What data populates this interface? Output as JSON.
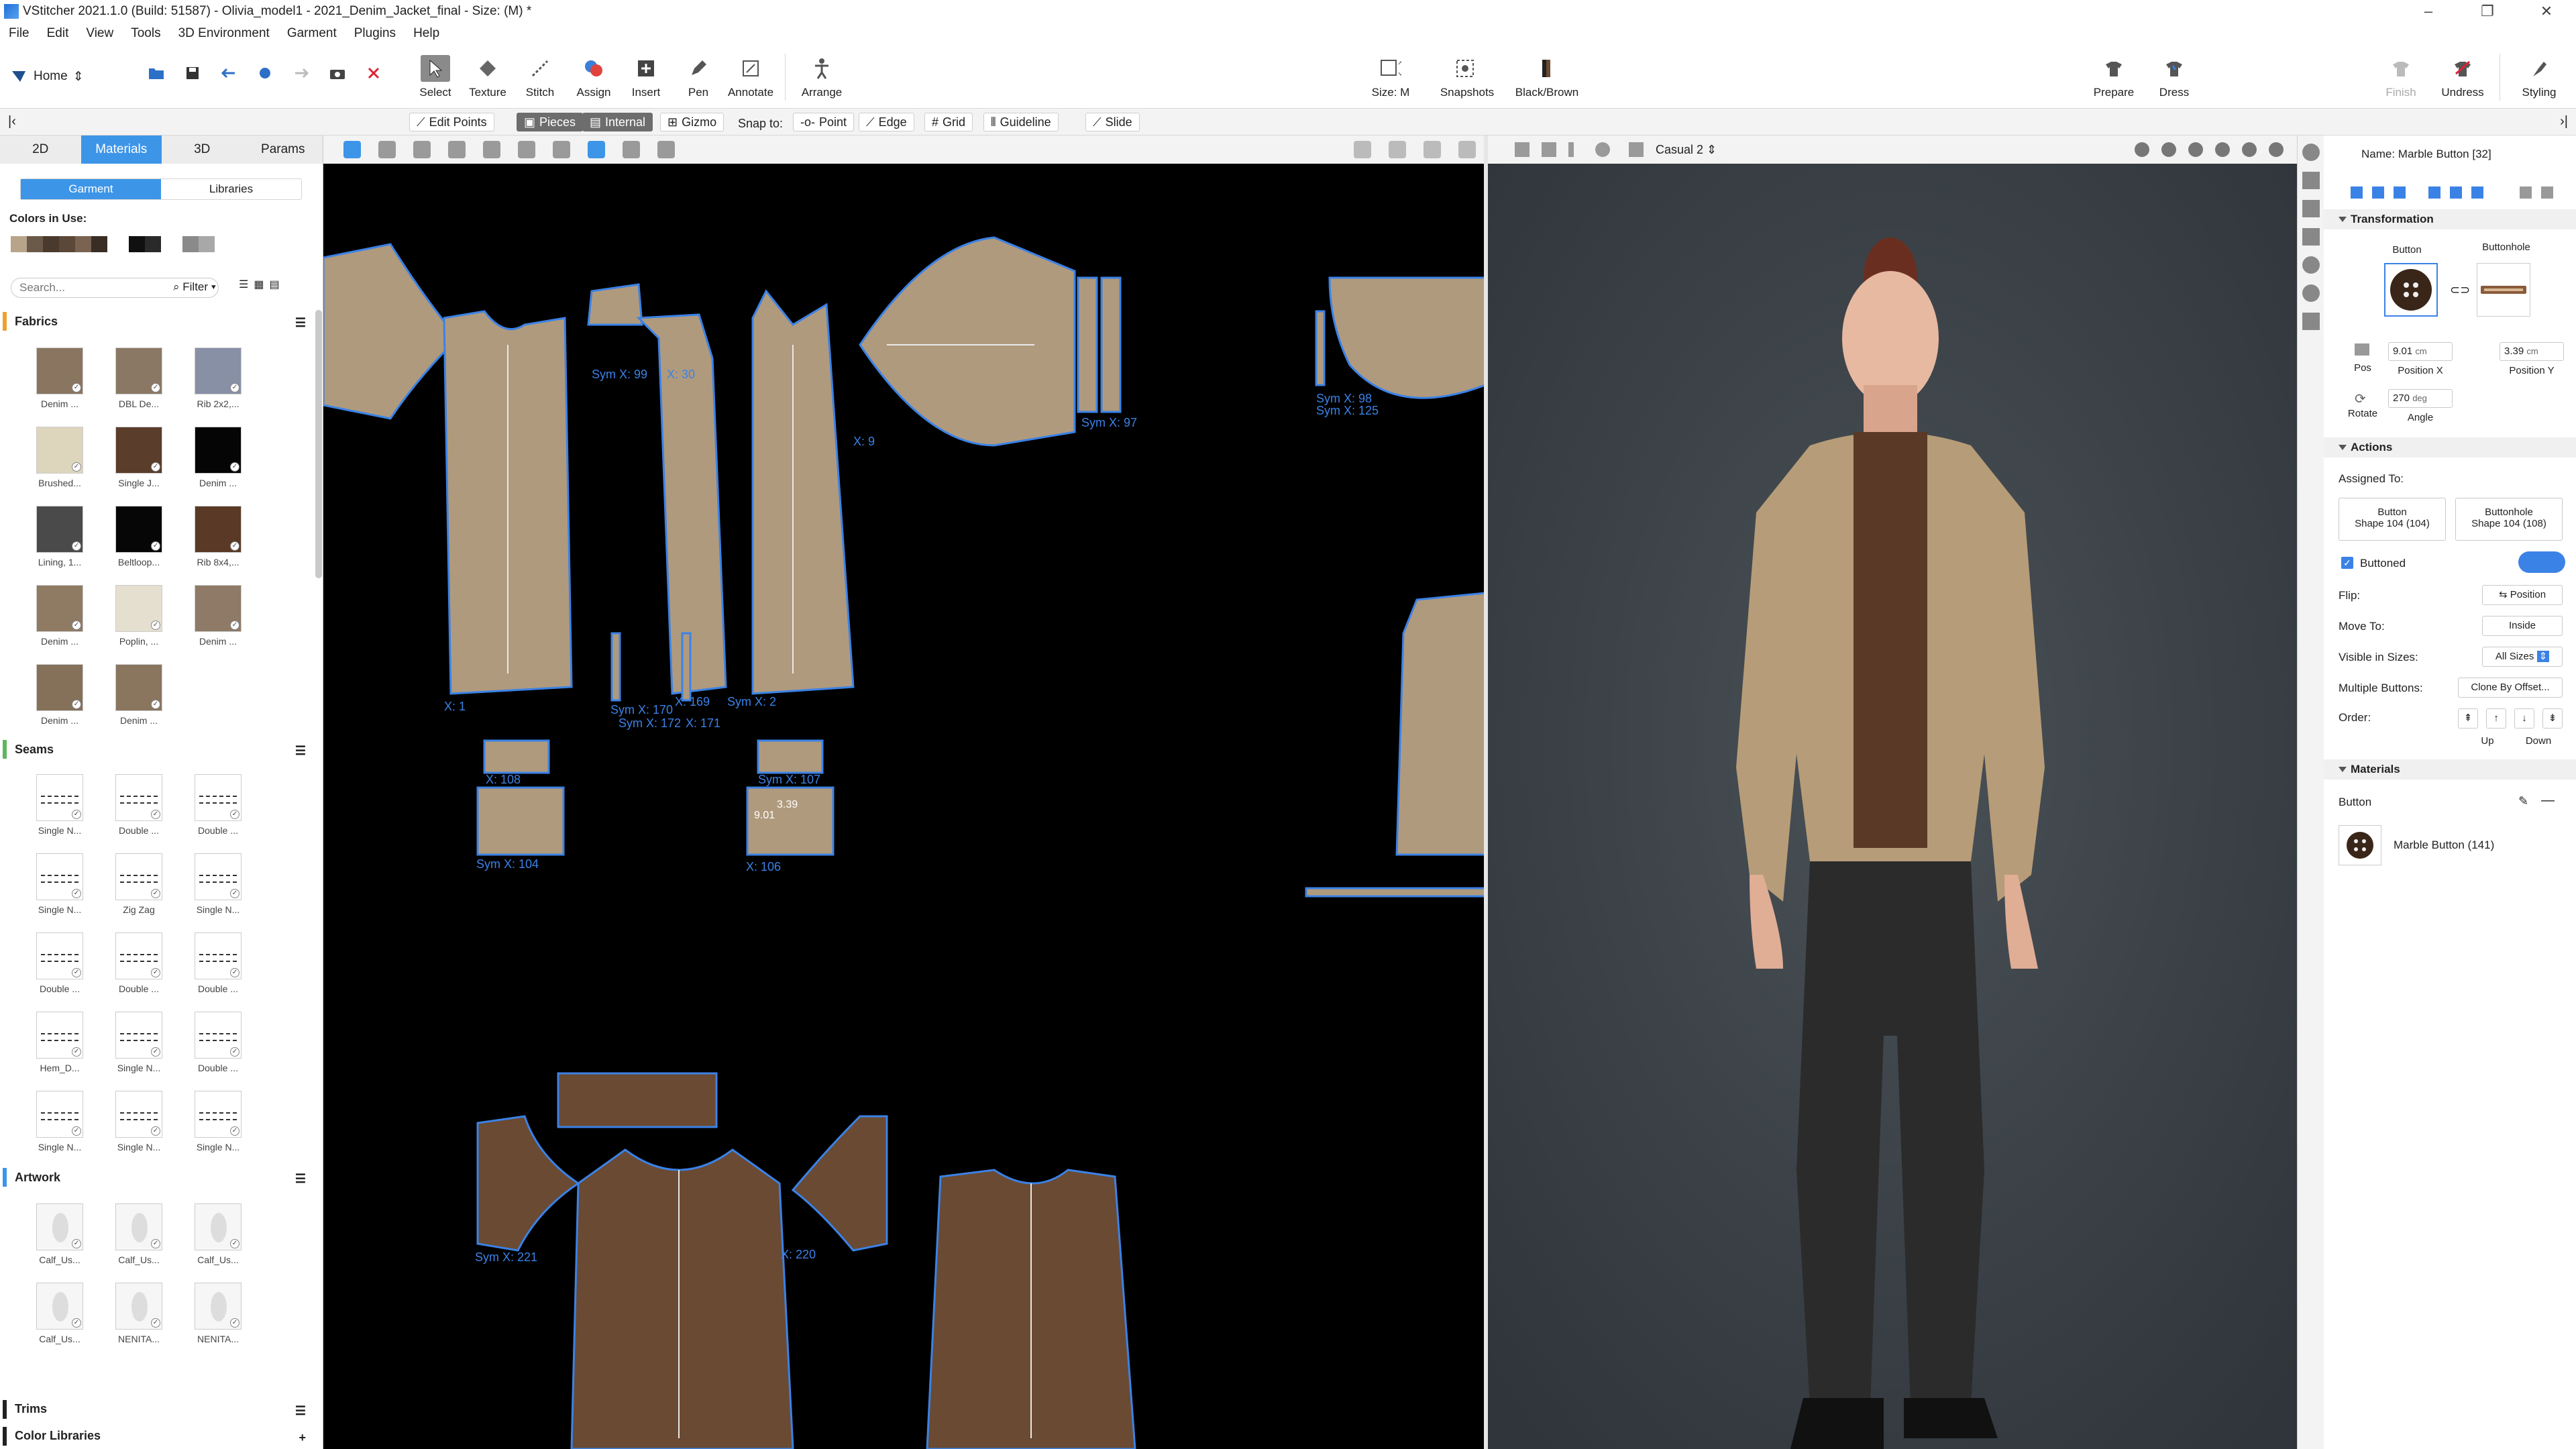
{
  "window": {
    "title": "VStitcher 2021.1.0 (Build: 51587) - Olivia_model1 - 2021_Denim_Jacket_final - Size: (M) *",
    "controls": [
      "–",
      "❐",
      "✕"
    ]
  },
  "menu": [
    "File",
    "Edit",
    "View",
    "Tools",
    "3D Environment",
    "Garment",
    "Plugins",
    "Help"
  ],
  "toolbar": {
    "home_label": "Home",
    "tools": [
      "Select",
      "Texture",
      "Stitch",
      "Assign",
      "Insert",
      "Pen",
      "Annotate",
      "Arrange"
    ],
    "size_label": "Size: M",
    "snapshots_label": "Snapshots",
    "colorway_label": "Black/Brown",
    "right_tools": [
      "Prepare",
      "Dress",
      "Finish",
      "Undress",
      "Styling"
    ]
  },
  "subtoolbar": {
    "edit_points": "Edit Points",
    "pieces": "Pieces",
    "internal": "Internal",
    "gizmo": "Gizmo",
    "snap_to": "Snap to:",
    "point": "Point",
    "edge": "Edge",
    "grid": "Grid",
    "guideline": "Guideline",
    "slide": "Slide"
  },
  "left_panel": {
    "tabs": [
      "2D",
      "Materials",
      "3D",
      "Params"
    ],
    "active_tab": "Materials",
    "segment": [
      "Garment",
      "Libraries"
    ],
    "colors_in_use_label": "Colors in Use:",
    "colors_in_use": [
      "#b8a48a",
      "#6b5a4a",
      "#4a3a2e",
      "#5c4838",
      "#7a6350",
      "#3a2d24",
      "#ffffff",
      "#101010",
      "#2a2a2a",
      "#ffffff",
      "#8a8a8a",
      "#a8a8a8"
    ],
    "search_placeholder": "Search...",
    "filter_label": "Filter",
    "sections": {
      "fabrics": "Fabrics",
      "seams": "Seams",
      "artwork": "Artwork",
      "trims": "Trims",
      "color_libraries": "Color Libraries"
    },
    "fabrics": [
      {
        "label": "Denim ...",
        "color": "#8a7560"
      },
      {
        "label": "DBL De...",
        "color": "#8a7864"
      },
      {
        "label": "Rib 2x2,...",
        "color": "#8890a6"
      },
      {
        "label": "Brushed...",
        "color": "#ddd5bc"
      },
      {
        "label": "Single J...",
        "color": "#5a3d2a"
      },
      {
        "label": "Denim ...",
        "color": "#050505"
      },
      {
        "label": "Lining, 1...",
        "color": "#4a4a4a"
      },
      {
        "label": "Beltloop...",
        "color": "#060606"
      },
      {
        "label": "Rib 8x4,...",
        "color": "#5a3a26"
      },
      {
        "label": "Denim ...",
        "color": "#8f7a64"
      },
      {
        "label": "Poplin, ...",
        "color": "#e4dfcf"
      },
      {
        "label": "Denim ...",
        "color": "#8e7a66"
      },
      {
        "label": "Denim ...",
        "color": "#85705a"
      },
      {
        "label": "Denim ...",
        "color": "#8a755f"
      }
    ],
    "seams": [
      "Single N...",
      "Double ...",
      "Double ...",
      "Single N...",
      "Zig Zag",
      "Single N...",
      "Double ...",
      "Double ...",
      "Double ...",
      "Hem_D...",
      "Single N...",
      "Double ...",
      "Single N...",
      "Single N...",
      "Single N..."
    ],
    "artwork": [
      "Calf_Us...",
      "Calf_Us...",
      "Calf_Us...",
      "Calf_Us...",
      "NENITA...",
      "NENITA..."
    ]
  },
  "pattern_labels": [
    "Sym X: 99",
    "X: 30",
    "X: 9",
    "X: 1",
    "Sym X: 170",
    "X: 169",
    "Sym X: 2",
    "Sym X: 172",
    "X: 171",
    "X: 108",
    "Sym X: 107",
    "Sym X: 104",
    "X: 106",
    "Sym X: 97",
    "Sym X: 98",
    "Sym X: 125",
    "Sym X: 221",
    "X: 220",
    "9.01",
    "3.39"
  ],
  "view3d": {
    "environment_label": "Casual 2"
  },
  "right_panel": {
    "name": "Name: Marble Button [32]",
    "transformation": "Transformation",
    "button_label": "Button",
    "buttonhole_label": "Buttonhole",
    "pos_label": "Pos",
    "position_x_value": "9.01",
    "position_x_unit": "cm",
    "position_x_label": "Position X",
    "position_y_value": "3.39",
    "position_y_unit": "cm",
    "position_y_label": "Position Y",
    "rotate_label": "Rotate",
    "angle_value": "270",
    "angle_unit": "deg",
    "angle_label": "Angle",
    "actions": "Actions",
    "assigned_to": "Assigned To:",
    "assigned_button_title": "Button",
    "assigned_button_shape": "Shape 104 (104)",
    "assigned_buttonhole_title": "Buttonhole",
    "assigned_buttonhole_shape": "Shape 104 (108)",
    "buttoned_label": "Buttoned",
    "flip_label": "Flip:",
    "flip_value": "Position",
    "move_to_label": "Move To:",
    "move_to_value": "Inside",
    "visible_in_sizes_label": "Visible in Sizes:",
    "visible_in_sizes_value": "All Sizes",
    "multiple_buttons_label": "Multiple Buttons:",
    "multiple_buttons_value": "Clone By Offset...",
    "order_label": "Order:",
    "up_label": "Up",
    "down_label": "Down",
    "materials": "Materials",
    "materials_button": "Button",
    "material_name": "Marble Button (141)"
  }
}
